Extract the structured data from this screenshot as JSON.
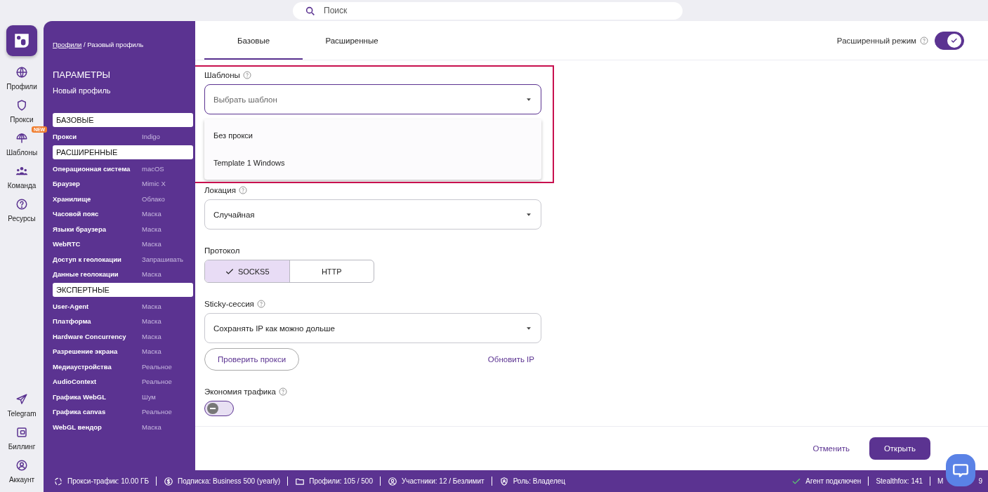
{
  "search": {
    "placeholder": "Поиск"
  },
  "rail": {
    "items": [
      {
        "label": "Профили"
      },
      {
        "label": "Прокси"
      },
      {
        "label": "Шаблоны",
        "badge": "NEW"
      },
      {
        "label": "Команда"
      },
      {
        "label": "Ресурсы"
      }
    ],
    "bottom": [
      {
        "label": "Telegram"
      },
      {
        "label": "Биллинг"
      },
      {
        "label": "Аккаунт"
      }
    ]
  },
  "panel": {
    "breadcrumb_link": "Профили",
    "breadcrumb_rest": " / Разовый профиль",
    "title": "ПАРАМЕТРЫ",
    "subtitle": "Новый профиль",
    "rows": [
      {
        "kind": "section",
        "label": "БАЗОВЫЕ"
      },
      {
        "kind": "param",
        "label": "Прокси",
        "value": "Indigo"
      },
      {
        "kind": "section",
        "label": "РАСШИРЕННЫЕ"
      },
      {
        "kind": "param",
        "label": "Операционная система",
        "value": "macOS"
      },
      {
        "kind": "param",
        "label": "Браузер",
        "value": "Mimic X"
      },
      {
        "kind": "param",
        "label": "Хранилище",
        "value": "Облако"
      },
      {
        "kind": "param",
        "label": "Часовой пояс",
        "value": "Маска"
      },
      {
        "kind": "param",
        "label": "Языки браузера",
        "value": "Маска"
      },
      {
        "kind": "param",
        "label": "WebRTC",
        "value": "Маска"
      },
      {
        "kind": "param",
        "label": "Доступ к геолокации",
        "value": "Запрашивать"
      },
      {
        "kind": "param",
        "label": "Данные геолокации",
        "value": "Маска"
      },
      {
        "kind": "section",
        "label": "ЭКСПЕРТНЫЕ"
      },
      {
        "kind": "param",
        "label": "User-Agent",
        "value": "Маска"
      },
      {
        "kind": "param",
        "label": "Платформа",
        "value": "Маска"
      },
      {
        "kind": "param",
        "label": "Hardware Concurrency",
        "value": "Маска"
      },
      {
        "kind": "param",
        "label": "Разрешение экрана",
        "value": "Маска"
      },
      {
        "kind": "param",
        "label": "Медиаустройства",
        "value": "Реальное"
      },
      {
        "kind": "param",
        "label": "AudioContext",
        "value": "Реальное"
      },
      {
        "kind": "param",
        "label": "Графика WebGL",
        "value": "Шум"
      },
      {
        "kind": "param",
        "label": "Графика canvas",
        "value": "Реальное"
      },
      {
        "kind": "param",
        "label": "WebGL вендор",
        "value": "Маска"
      }
    ]
  },
  "tabs": [
    {
      "label": "Базовые",
      "selected": true
    },
    {
      "label": "Расширенные",
      "selected": false
    }
  ],
  "advanced_mode": {
    "label": "Расширенный режим",
    "on": true
  },
  "templates": {
    "label": "Шаблоны",
    "placeholder": "Выбрать шаблон",
    "expanded": true,
    "options": [
      "Без прокси",
      "Template 1 Windows"
    ]
  },
  "location": {
    "label": "Локация",
    "value": "Случайная"
  },
  "protocol": {
    "label": "Протокол",
    "options": [
      {
        "label": "SOCKS5",
        "selected": true
      },
      {
        "label": "HTTP",
        "selected": false
      }
    ]
  },
  "sticky": {
    "label": "Sticky-сессия",
    "value": "Сохранять IP как можно дольше"
  },
  "check_button": "Проверить прокси",
  "refresh_link": "Обновить IP",
  "traffic_saving": {
    "label": "Экономия трафика",
    "on": false
  },
  "footer": {
    "cancel": "Отменить",
    "open": "Открыть"
  },
  "status_bar": {
    "left": [
      {
        "text": "Прокси-трафик: 10.00 ГБ"
      },
      {
        "text": "Подписка: Business 500 (yearly)"
      },
      {
        "text": "Профили: 105 / 500"
      },
      {
        "text": "Участники: 12 / Безлимит"
      },
      {
        "text": "Роль: Владелец"
      }
    ],
    "right": [
      {
        "text": "Агент подключен"
      },
      {
        "text": "Stealthfox: 141"
      },
      {
        "text": "M"
      }
    ],
    "tail": "9"
  }
}
